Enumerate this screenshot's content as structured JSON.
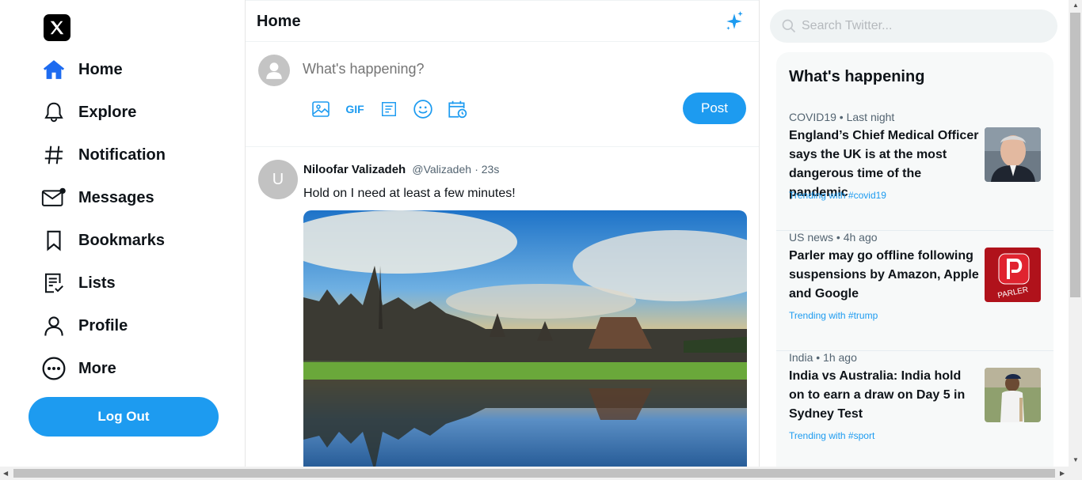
{
  "nav": {
    "items": [
      {
        "label": "Home",
        "icon": "home-icon"
      },
      {
        "label": "Explore",
        "icon": "bell-icon"
      },
      {
        "label": "Notification",
        "icon": "hashtag-icon"
      },
      {
        "label": "Messages",
        "icon": "mail-icon"
      },
      {
        "label": "Bookmarks",
        "icon": "bookmark-icon"
      },
      {
        "label": "Lists",
        "icon": "list-icon"
      },
      {
        "label": "Profile",
        "icon": "user-icon"
      },
      {
        "label": "More",
        "icon": "more-icon"
      }
    ],
    "active": "Home",
    "logout_label": "Log Out"
  },
  "main": {
    "title": "Home",
    "composer": {
      "placeholder": "What's happening?",
      "gif_label": "GIF",
      "post_label": "Post"
    },
    "tweet": {
      "avatar_letter": "U",
      "name": "Niloofar Valizadeh",
      "handle": "@Valizadeh",
      "time": "· 23s",
      "text": "Hold on I need at least a few minutes!"
    }
  },
  "right": {
    "search_placeholder": "Search Twitter...",
    "panel_title": "What's happening",
    "trends": [
      {
        "meta": "COVID19 • Last night",
        "title": "England’s Chief Medical Officer says the UK is at the most dangerous time of the pandemic",
        "tag": "Trending with #covid19"
      },
      {
        "meta": "US news • 4h ago",
        "title": "Parler may go offline following suspensions by Amazon, Apple and Google",
        "tag": "Trending with #trump",
        "thumb_text": "PARLER"
      },
      {
        "meta": "India • 1h ago",
        "title": "India vs Australia: India hold on to earn a draw on Day 5 in Sydney Test",
        "tag": "Trending with #sport"
      }
    ]
  },
  "colors": {
    "accent": "#1d9bf0",
    "text": "#0f1419",
    "muted": "#536471"
  }
}
